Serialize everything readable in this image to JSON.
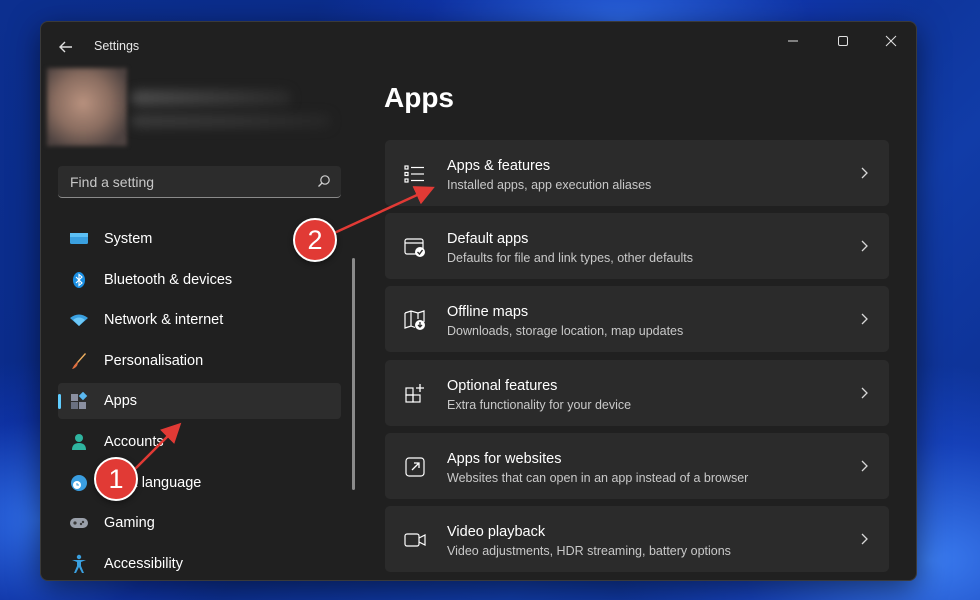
{
  "window": {
    "title": "Settings"
  },
  "search": {
    "placeholder": "Find a setting"
  },
  "sidebar": {
    "items": [
      {
        "label": "System",
        "icon": "monitor-icon"
      },
      {
        "label": "Bluetooth & devices",
        "icon": "bluetooth-icon"
      },
      {
        "label": "Network & internet",
        "icon": "wifi-icon"
      },
      {
        "label": "Personalisation",
        "icon": "paintbrush-icon"
      },
      {
        "label": "Apps",
        "icon": "apps-icon",
        "selected": true
      },
      {
        "label": "Accounts",
        "icon": "person-icon"
      },
      {
        "label": "& language",
        "icon": "globe-clock-icon"
      },
      {
        "label": "Gaming",
        "icon": "gamepad-icon"
      },
      {
        "label": "Accessibility",
        "icon": "accessibility-icon"
      }
    ]
  },
  "main": {
    "title": "Apps",
    "cards": [
      {
        "title": "Apps & features",
        "subtitle": "Installed apps, app execution aliases",
        "icon": "list-icon"
      },
      {
        "title": "Default apps",
        "subtitle": "Defaults for file and link types, other defaults",
        "icon": "default-apps-icon"
      },
      {
        "title": "Offline maps",
        "subtitle": "Downloads, storage location, map updates",
        "icon": "map-download-icon"
      },
      {
        "title": "Optional features",
        "subtitle": "Extra functionality for your device",
        "icon": "grid-add-icon"
      },
      {
        "title": "Apps for websites",
        "subtitle": "Websites that can open in an app instead of a browser",
        "icon": "open-external-icon"
      },
      {
        "title": "Video playback",
        "subtitle": "Video adjustments, HDR streaming, battery options",
        "icon": "video-camera-icon"
      }
    ]
  },
  "annotations": {
    "step1": "1",
    "step2": "2",
    "color": "#e13a35"
  },
  "colors": {
    "accent": "#60cdff",
    "window_bg": "#202020",
    "card_bg": "#2b2b2b"
  }
}
